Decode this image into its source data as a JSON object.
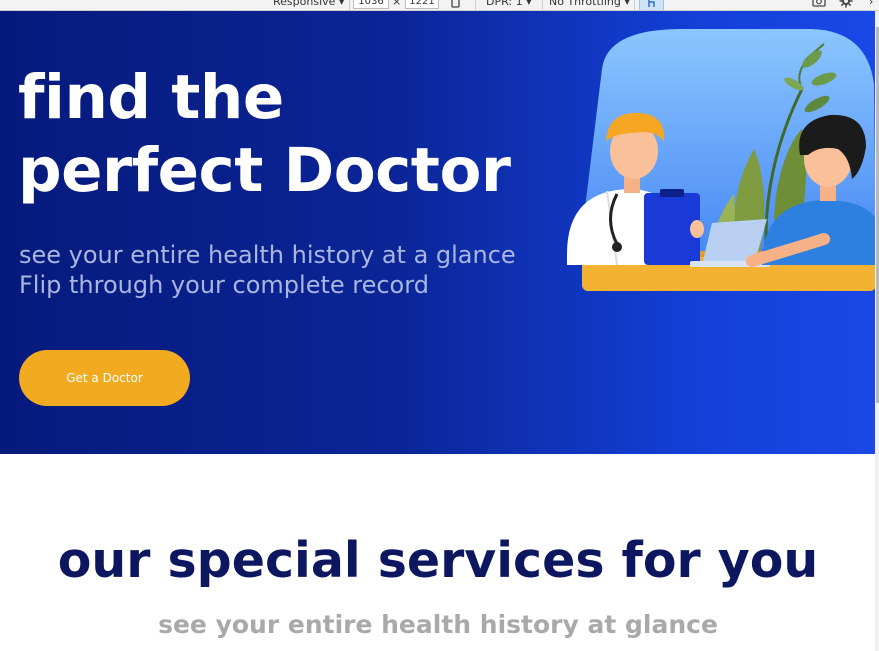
{
  "devtools": {
    "device_select": "Responsive",
    "width_value": "1036",
    "times_sign": "×",
    "height_value": "1221",
    "dpr_select": "DPR: 1",
    "throttle_select": "No Throttling"
  },
  "hero": {
    "title_line1": "find the",
    "title_line2": "perfect Doctor",
    "subtitle": "see your entire health history at a glance Flip through your complete record",
    "cta_label": "Get a Doctor"
  },
  "services": {
    "title": "our special services for you",
    "subtitle": "see your entire health history at glance"
  },
  "colors": {
    "hero_gradient_start": "#061a7c",
    "hero_gradient_end": "#1a48e6",
    "cta_background": "#f2aa21",
    "services_title": "#0c1760",
    "services_subtitle": "#a9a9a9"
  },
  "icons": [
    "rotate-device-icon",
    "screenshot-icon",
    "settings-gear-icon",
    "touch-simulation-icon",
    "close-icon"
  ]
}
